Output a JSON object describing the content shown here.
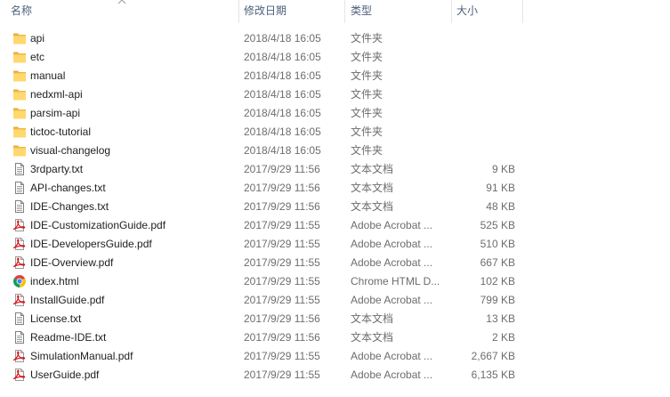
{
  "header": {
    "sort_indicator": "chevron-up-icon",
    "columns": [
      {
        "label": "名称"
      },
      {
        "label": "修改日期"
      },
      {
        "label": "类型"
      },
      {
        "label": "大小"
      }
    ]
  },
  "files": [
    {
      "name": "api",
      "modified": "2018/4/18 16:05",
      "type": "文件夹",
      "icon": "folder-icon"
    },
    {
      "name": "etc",
      "modified": "2018/4/18 16:05",
      "type": "文件夹",
      "icon": "folder-icon"
    },
    {
      "name": "manual",
      "modified": "2018/4/18 16:05",
      "type": "文件夹",
      "icon": "folder-icon"
    },
    {
      "name": "nedxml-api",
      "modified": "2018/4/18 16:05",
      "type": "文件夹",
      "icon": "folder-icon"
    },
    {
      "name": "parsim-api",
      "modified": "2018/4/18 16:05",
      "type": "文件夹",
      "icon": "folder-icon"
    },
    {
      "name": "tictoc-tutorial",
      "modified": "2018/4/18 16:05",
      "type": "文件夹",
      "icon": "folder-icon"
    },
    {
      "name": "visual-changelog",
      "modified": "2018/4/18 16:05",
      "type": "文件夹",
      "icon": "folder-icon"
    },
    {
      "name": "3rdparty.txt",
      "modified": "2017/9/29 11:56",
      "type": "文本文档",
      "size": "9 KB",
      "icon": "text-file-icon"
    },
    {
      "name": "API-changes.txt",
      "modified": "2017/9/29 11:56",
      "type": "文本文档",
      "size": "91 KB",
      "icon": "text-file-icon"
    },
    {
      "name": "IDE-Changes.txt",
      "modified": "2017/9/29 11:56",
      "type": "文本文档",
      "size": "48 KB",
      "icon": "text-file-icon"
    },
    {
      "name": "IDE-CustomizationGuide.pdf",
      "modified": "2017/9/29 11:55",
      "type": "Adobe Acrobat ...",
      "size": "525 KB",
      "icon": "pdf-icon"
    },
    {
      "name": "IDE-DevelopersGuide.pdf",
      "modified": "2017/9/29 11:55",
      "type": "Adobe Acrobat ...",
      "size": "510 KB",
      "icon": "pdf-icon"
    },
    {
      "name": "IDE-Overview.pdf",
      "modified": "2017/9/29 11:55",
      "type": "Adobe Acrobat ...",
      "size": "667 KB",
      "icon": "pdf-icon"
    },
    {
      "name": "index.html",
      "modified": "2017/9/29 11:55",
      "type": "Chrome HTML D...",
      "size": "102 KB",
      "icon": "chrome-html-icon"
    },
    {
      "name": "InstallGuide.pdf",
      "modified": "2017/9/29 11:55",
      "type": "Adobe Acrobat ...",
      "size": "799 KB",
      "icon": "pdf-icon"
    },
    {
      "name": "License.txt",
      "modified": "2017/9/29 11:56",
      "type": "文本文档",
      "size": "13 KB",
      "icon": "text-file-icon"
    },
    {
      "name": "Readme-IDE.txt",
      "modified": "2017/9/29 11:56",
      "type": "文本文档",
      "size": "2 KB",
      "icon": "text-file-icon"
    },
    {
      "name": "SimulationManual.pdf",
      "modified": "2017/9/29 11:55",
      "type": "Adobe Acrobat ...",
      "size": "2,667 KB",
      "icon": "pdf-icon"
    },
    {
      "name": "UserGuide.pdf",
      "modified": "2017/9/29 11:55",
      "type": "Adobe Acrobat ...",
      "size": "6,135 KB",
      "icon": "pdf-icon"
    }
  ],
  "colors": {
    "header_text": "#4c607a",
    "name_text": "#1e1e1e",
    "detail_text": "#6d6d6d",
    "separator": "#e5e5e5",
    "background": "#ffffff"
  }
}
